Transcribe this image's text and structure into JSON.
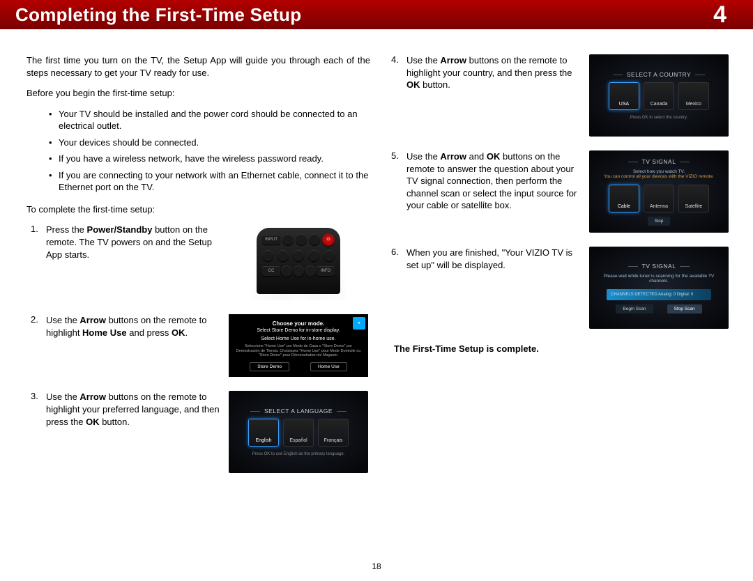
{
  "header": {
    "title": "Completing the First-Time Setup",
    "chapter": "4"
  },
  "page_number": "18",
  "intro": "The first time you turn on the TV, the Setup App will guide you through each of the steps necessary to get your TV ready for use.",
  "before_label": "Before you begin the first-time setup:",
  "pre": [
    "Your TV should be installed and the power cord should be connected to an electrical outlet.",
    "Your devices should be connected.",
    "If you have a wireless network, have the wireless password ready.",
    "If you are connecting to your network with an Ethernet cable, connect it to the Ethernet port on the TV."
  ],
  "complete_label": "To complete the first-time setup:",
  "steps": {
    "s1": {
      "pre": "Press the ",
      "b1": "Power/Standby",
      "post": " button on the remote. The TV powers on and the Setup App starts."
    },
    "s2": {
      "pre": "Use the ",
      "b1": "Arrow",
      "mid": " buttons on the remote to highlight ",
      "b2": "Home Use",
      "mid2": " and press ",
      "b3": "OK",
      "post": "."
    },
    "s3": {
      "pre": "Use the ",
      "b1": "Arrow",
      "mid": " buttons on the remote to highlight your preferred language, and then press the ",
      "b2": "OK",
      "post": " button."
    },
    "s4": {
      "pre": "Use the ",
      "b1": "Arrow",
      "mid": " buttons on the remote to highlight your country, and then press the ",
      "b2": "OK",
      "post": " button."
    },
    "s5": {
      "pre": "Use the ",
      "b1": "Arrow",
      "mid": " and ",
      "b2": "OK",
      "post": " buttons on the remote to answer the question about your TV signal connection, then perform the channel scan or select the input source for your cable or satellite box."
    },
    "s6": {
      "text": "When you are finished, \"Your VIZIO TV is set up\" will be displayed."
    }
  },
  "complete_msg": "The First-Time Setup is complete.",
  "fig_remote": {
    "input": "INPUT",
    "power": "⏻",
    "cc": "CC",
    "info": "INFO"
  },
  "fig_mode": {
    "title": "Choose your mode.",
    "l1": "Select Store Demo for in-store display.",
    "l2": "Select Home Use for in-home use.",
    "sub": "Seleccione \"Home Use\" por Modo de Casa o \"Store Demo\" por Demostración de Tienda. Choisissez \"Home Use\" pour Mode Domicile ou \"Store Demo\" pour Démonstration de Magasin.",
    "b1": "Store Demo",
    "b2": "Home Use"
  },
  "fig_lang": {
    "title": "SELECT A LANGUAGE",
    "opts": [
      "English",
      "Español",
      "Français"
    ],
    "hint": "Press OK to use English as the primary language."
  },
  "fig_country": {
    "title": "SELECT A COUNTRY",
    "opts": [
      "USA",
      "Canada",
      "Mexico"
    ],
    "hint": "Press OK to select the country."
  },
  "fig_signal1": {
    "title": "TV SIGNAL",
    "sub": "Select how you watch TV.",
    "sub2": "You can control all your devices with the VIZIO remote.",
    "opts": [
      "Cable",
      "Antenna",
      "Satellite"
    ],
    "skip": "Skip"
  },
  "fig_signal2": {
    "title": "TV SIGNAL",
    "sub": "Please wait while tuner is scanning for the available TV channels.",
    "bar": "CHANNELS DETECTED   Analog: 0   Digital: 0",
    "b1": "Begin Scan",
    "b2": "Stop Scan"
  }
}
